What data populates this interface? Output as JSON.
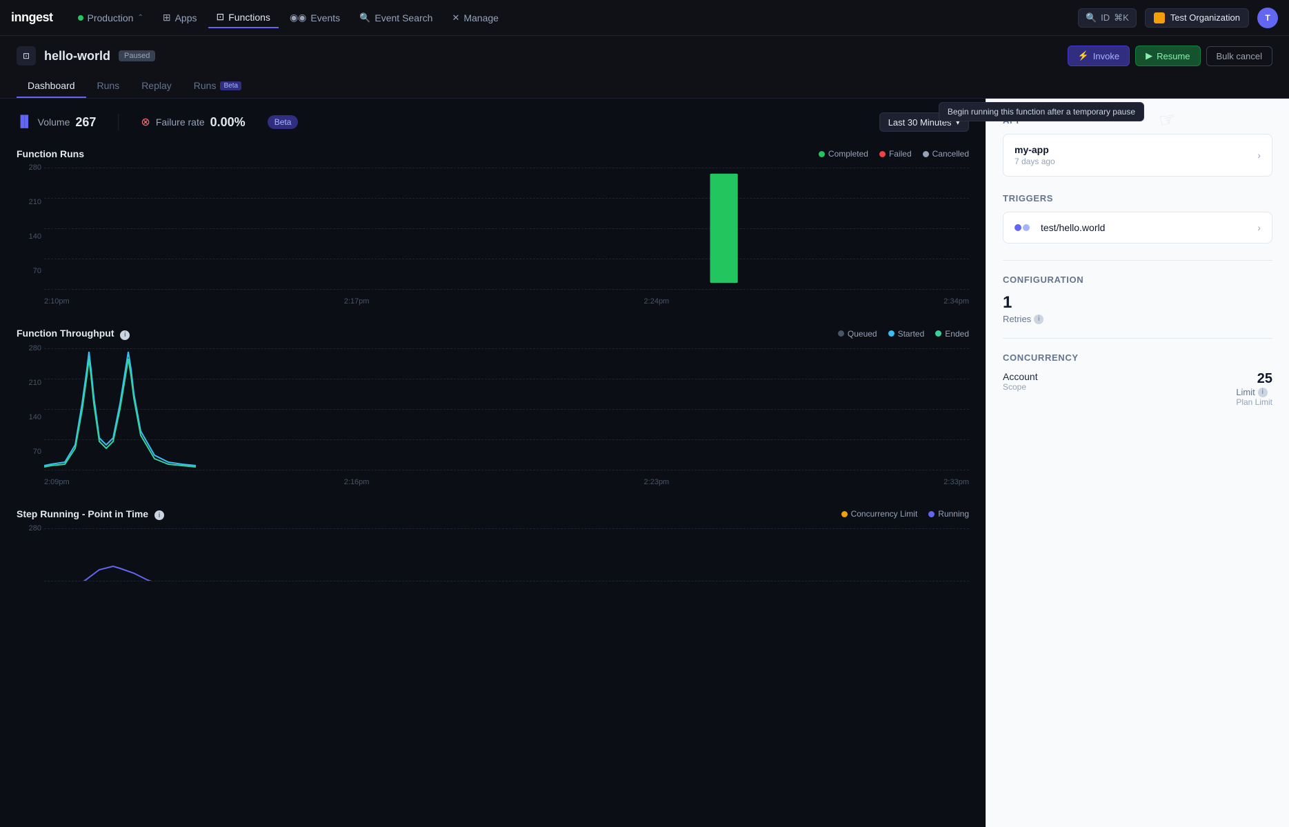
{
  "app": {
    "logo": "inngest"
  },
  "navbar": {
    "production_label": "Production",
    "apps_label": "Apps",
    "functions_label": "Functions",
    "events_label": "Events",
    "event_search_label": "Event Search",
    "manage_label": "Manage",
    "id_button_label": "ID",
    "keyboard_shortcut": "⌘K",
    "org_name": "Test Organization",
    "avatar_initials": "T"
  },
  "function": {
    "name": "hello-world",
    "status": "Paused",
    "icon": "⊡"
  },
  "actions": {
    "invoke_label": "Invoke",
    "resume_label": "Resume",
    "bulk_cancel_label": "Bulk cancel",
    "tooltip": "Begin running this function after a temporary pause"
  },
  "tabs": [
    {
      "label": "Dashboard",
      "active": true
    },
    {
      "label": "Runs",
      "active": false
    },
    {
      "label": "Replay",
      "active": false
    },
    {
      "label": "Runs",
      "active": false,
      "badge": "Beta"
    }
  ],
  "metrics": {
    "volume_label": "Volume",
    "volume_value": "267",
    "failure_rate_label": "Failure rate",
    "failure_rate_value": "0.00%",
    "time_range": "Last 30 Minutes"
  },
  "function_runs_chart": {
    "title": "Function Runs",
    "legend": [
      {
        "label": "Completed",
        "color": "#22c55e"
      },
      {
        "label": "Failed",
        "color": "#ef4444"
      },
      {
        "label": "Cancelled",
        "color": "#94a3b8"
      }
    ],
    "y_labels": [
      "280",
      "210",
      "140",
      "70"
    ],
    "x_labels": [
      "2:10pm",
      "2:17pm",
      "2:24pm",
      "2:34pm"
    ]
  },
  "throughput_chart": {
    "title": "Function Throughput",
    "info": true,
    "legend": [
      {
        "label": "Queued",
        "color": "#475569"
      },
      {
        "label": "Started",
        "color": "#38bdf8"
      },
      {
        "label": "Ended",
        "color": "#34d399"
      }
    ],
    "y_labels": [
      "280",
      "210",
      "140",
      "70"
    ],
    "x_labels": [
      "2:09pm",
      "2:16pm",
      "2:23pm",
      "2:33pm"
    ]
  },
  "step_chart": {
    "title": "Step Running - Point in Time",
    "info": true,
    "legend": [
      {
        "label": "Concurrency Limit",
        "color": "#f59e0b"
      },
      {
        "label": "Running",
        "color": "#6366f1"
      }
    ],
    "y_labels": [
      "280"
    ],
    "x_labels": []
  },
  "sidebar": {
    "app_section": "App",
    "app_name": "my-app",
    "app_time": "7 days ago",
    "triggers_section": "Triggers",
    "trigger_name": "test/hello.world",
    "config_section": "Configuration",
    "retries_value": "1",
    "retries_label": "Retries",
    "concurrency_section": "Concurrency",
    "account_label": "Account",
    "scope_label": "Scope",
    "limit_value": "25",
    "limit_label": "Limit",
    "plan_limit_label": "Plan Limit"
  }
}
